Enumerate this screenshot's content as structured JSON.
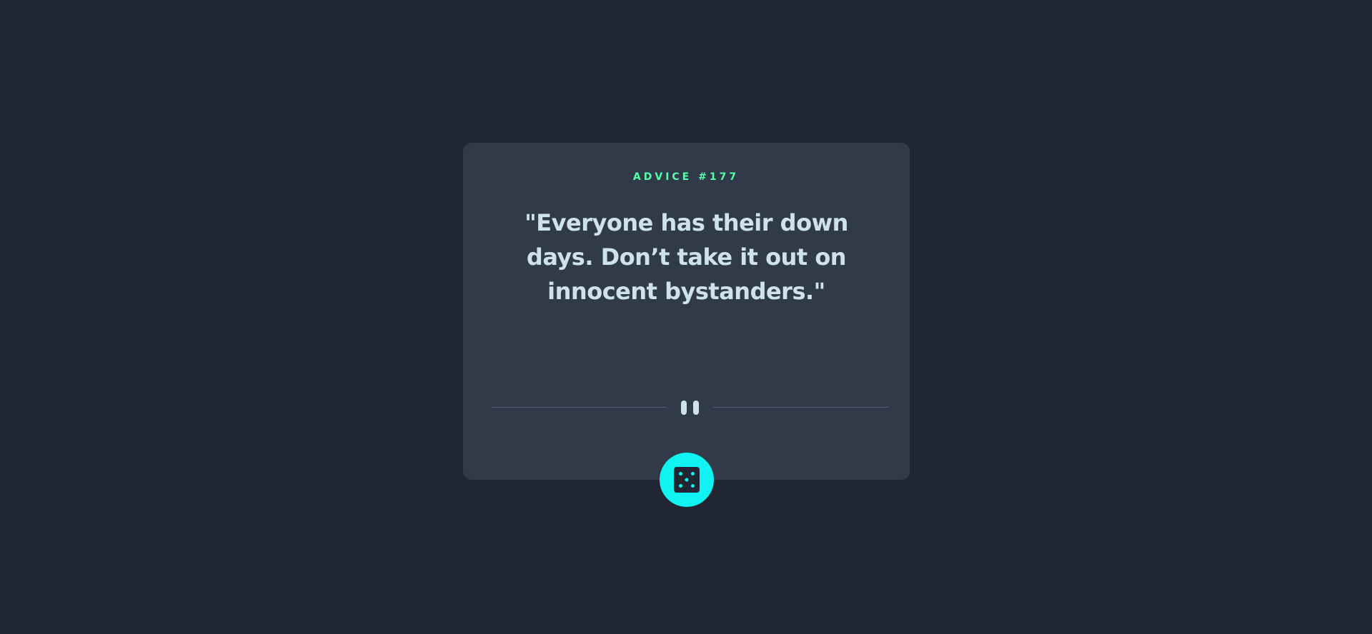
{
  "advice": {
    "label": "ADVICE #177",
    "text": "\"Everyone has their down days. Don’t take it out on innocent bystanders.\""
  },
  "divider": {
    "icon": "pause-icon"
  },
  "button": {
    "icon": "dice-icon",
    "accent_color": "#0ff3f3"
  },
  "colors": {
    "background": "#202632",
    "card": "#313a49",
    "label": "#53ffab",
    "text": "#cee3e9",
    "divider": "#4f5d74"
  }
}
